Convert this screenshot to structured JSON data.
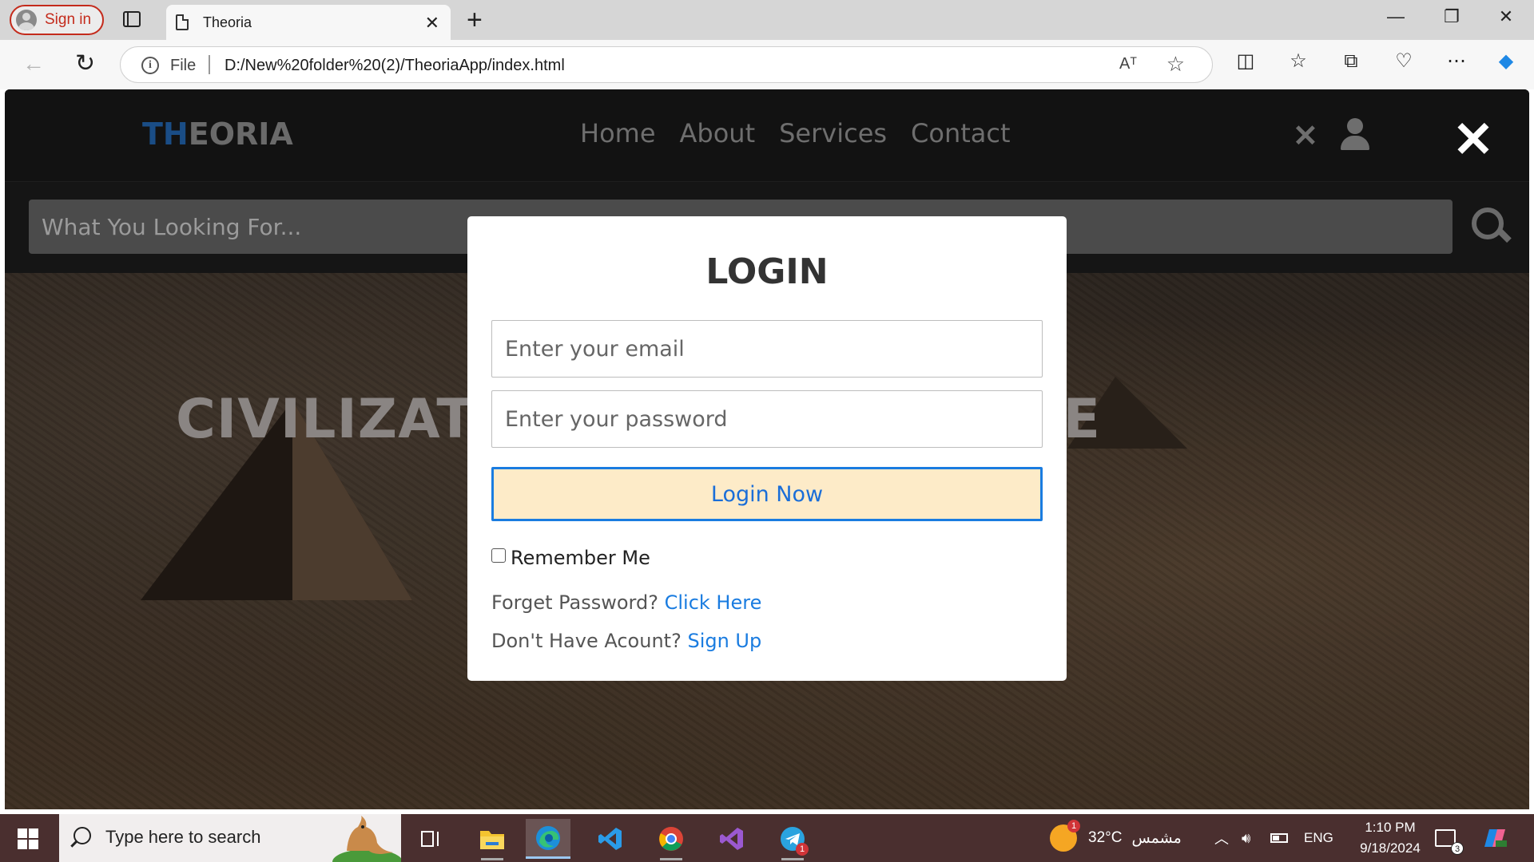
{
  "browser": {
    "signin_label": "Sign in",
    "tab_title": "Theoria",
    "address_scheme": "File",
    "url": "D:/New%20folder%20(2)/TheoriaApp/index.html",
    "read_aloud_label": "Aᵀ"
  },
  "site": {
    "logo_part1": "TH",
    "logo_part2": "EORIA",
    "nav": [
      "Home",
      "About",
      "Services",
      "Contact"
    ],
    "search_placeholder": "What You Looking For...",
    "hero_title": "CIVILIZATION OF THE FUTURE"
  },
  "login": {
    "title": "LOGIN",
    "email_placeholder": "Enter your email",
    "password_placeholder": "Enter your password",
    "button_label": "Login Now",
    "remember_label": "Remember Me",
    "forgot_text": "Forget Password?",
    "forgot_link": "Click Here",
    "signup_text": "Don't Have Acount?",
    "signup_link": "Sign Up"
  },
  "taskbar": {
    "search_placeholder": "Type here to search",
    "weather_temp": "32°C",
    "weather_desc": "مشمس",
    "language": "ENG",
    "time": "1:10 PM",
    "date": "9/18/2024",
    "notification_count": "3",
    "weather_badge": "1",
    "telegram_badge": "1"
  },
  "colors": {
    "accent_blue": "#1a7ce0",
    "login_button_bg": "#fdebc8",
    "logo_blue": "#1a4d86",
    "taskbar_bg": "#4a2f2f"
  }
}
